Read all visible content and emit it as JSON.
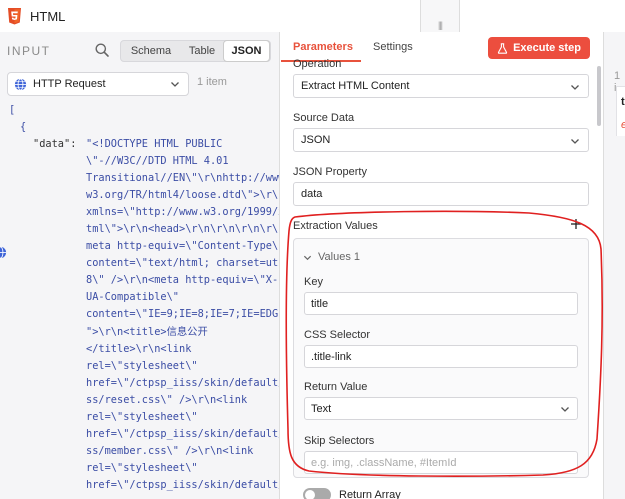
{
  "topbar": {
    "title": "HTML",
    "drag_handle": "|||"
  },
  "input_panel": {
    "label": "INPUT",
    "view_options": [
      "Schema",
      "Table",
      "JSON"
    ],
    "selected_view": "JSON",
    "source_node": "HTTP Request",
    "item_count": "1 item",
    "json": {
      "open_bracket": "[",
      "open_brace": "{",
      "key": "\"data\":",
      "value_lines": [
        "\"<!DOCTYPE HTML PUBLIC",
        "\\\"-//W3C//DTD HTML 4.01",
        "Transitional//EN\\\"\\r\\nhttp://www.",
        "w3.org/TR/html4/loose.dtd\\\">\\r\\n<html",
        "xmlns=\\\"http://www.w3.org/1999/xh",
        "tml\\\">\\r\\n<head>\\r\\n\\r\\n\\r\\n\\r\\n<",
        "meta http-equiv=\\\"Content-Type\\\"",
        "content=\\\"text/html; charset=utf-",
        "8\\\" />\\r\\n<meta http-equiv=\\\"X-",
        "UA-Compatible\\\"",
        "content=\\\"IE=9;IE=8;IE=7;IE=EDGE\\",
        "\">\\r\\n<title>信息公开",
        "</title>\\r\\n<link",
        "rel=\\\"stylesheet\\\"",
        "href=\\\"/ctpsp_iiss/skin/default/c",
        "ss/reset.css\\\" />\\r\\n<link",
        "rel=\\\"stylesheet\\\"",
        "href=\\\"/ctpsp_iiss/skin/default/c",
        "ss/member.css\\\" />\\r\\n<link",
        "rel=\\\"stylesheet\\\"",
        "href=\\\"/ctpsp_iiss/skin/default/c"
      ]
    }
  },
  "parameters_panel": {
    "tabs": [
      "Parameters",
      "Settings"
    ],
    "active_tab": "Parameters",
    "execute_label": "Execute step",
    "operation_label": "Operation",
    "operation_value": "Extract HTML Content",
    "source_data_label": "Source Data",
    "source_data_value": "JSON",
    "json_property_label": "JSON Property",
    "json_property_value": "data",
    "extraction_values_label": "Extraction Values",
    "values": {
      "title": "Values 1",
      "key_label": "Key",
      "key_value": "title",
      "css_selector_label": "CSS Selector",
      "css_selector_value": ".title-link",
      "return_value_label": "Return Value",
      "return_value_value": "Text",
      "skip_selectors_label": "Skip Selectors",
      "skip_selectors_placeholder": "e.g. img, .className, #ItemId"
    },
    "return_array_label": "Return Array",
    "return_array_on": false
  },
  "output_panel": {
    "item_count": "1 i",
    "key_fragment": "ti",
    "value_fragment": "e"
  },
  "colors": {
    "accent": "#e8523c",
    "execute_button": "#ec4e3e",
    "json_value": "#3b4da5",
    "annotation": "#e02020"
  },
  "icons": [
    "html5-icon",
    "search-icon",
    "globe-icon",
    "chevron-down-icon",
    "flask-icon",
    "plus-icon"
  ]
}
